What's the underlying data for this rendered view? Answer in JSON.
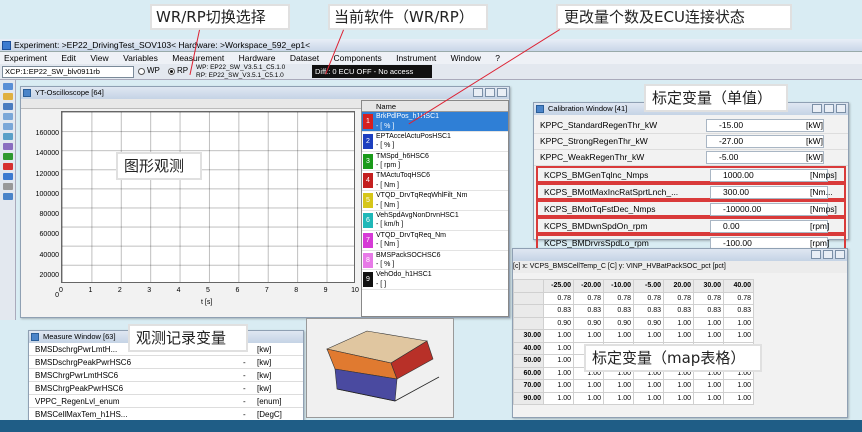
{
  "callouts": {
    "wp_rp_switch": "WR/RP切换选择",
    "current_software": "当前软件（WR/RP）",
    "change_status": "更改量个数及ECU连接状态",
    "calibration_single": "标定变量（单值）",
    "graph_observe": "图形观测",
    "measure_record": "观测记录变量",
    "calibration_map": "标定变量（map表格）"
  },
  "app": {
    "title": "Experiment: >EP22_DrivingTest_SOV103< Hardware: >Workspace_592_ep1<"
  },
  "menu": [
    "Experiment",
    "Edit",
    "View",
    "Variables",
    "Measurement",
    "Hardware",
    "Dataset",
    "Components",
    "Instrument",
    "Window",
    "?"
  ],
  "toolbar": {
    "xcp_select": "XCP:1:EP22_SW_blv0911rb",
    "radio_wp": "WP",
    "radio_rp": "RP",
    "wp_line": "WP: EP22_SW_V3.5.1_C5.1.0",
    "rp_line": "RP: EP22_SW_V3.5.1_C5.1.0",
    "status": "Diff.: 0    ECU OFF - No access"
  },
  "oscilloscope": {
    "title": "YT-Oscilloscope [64]",
    "list_header": "Name",
    "x_label": "t [s]",
    "signals": [
      {
        "num": "1",
        "name": "BrkPdlPos_h1HSC1",
        "unit": "- [ % ]",
        "color": "#d42020"
      },
      {
        "num": "2",
        "name": "EPTAccelActuPosHSC1",
        "unit": "- [ % ]",
        "color": "#1d3fbf"
      },
      {
        "num": "3",
        "name": "TMSpd_h6HSC6",
        "unit": "- [ rpm ]",
        "color": "#1a9a1a"
      },
      {
        "num": "4",
        "name": "TMActuToqHSC6",
        "unit": "- [ Nm ]",
        "color": "#c41f1f"
      },
      {
        "num": "5",
        "name": "VTQD_DrvTqReqWhlFilt_Nm",
        "unit": "- [ Nm ]",
        "color": "#d6c619"
      },
      {
        "num": "6",
        "name": "VehSpdAvgNonDrvnHSC1",
        "unit": "- [ km/h ]",
        "color": "#1fb8b8"
      },
      {
        "num": "7",
        "name": "VTQD_DrvTqReq_Nm",
        "unit": "- [ Nm ]",
        "color": "#d63ad6"
      },
      {
        "num": "8",
        "name": "BMSPackSOCHSC6",
        "unit": "- [ % ]",
        "color": "#e77ae7"
      },
      {
        "num": "9",
        "name": "VehOdo_h1HSC1",
        "unit": "- [ ]",
        "color": "#111111"
      }
    ]
  },
  "chart_data": {
    "type": "line",
    "title": "",
    "xlabel": "t [s]",
    "ylabel": "",
    "x_ticks": [
      "0",
      "1",
      "2",
      "3",
      "4",
      "5",
      "6",
      "7",
      "8",
      "9",
      "10"
    ],
    "y_ticks": [
      "160000",
      "140000",
      "120000",
      "100000",
      "80000",
      "60000",
      "40000",
      "20000",
      "0"
    ],
    "xlim": [
      0,
      10
    ],
    "ylim": [
      0,
      170000
    ],
    "series": [],
    "grid": true
  },
  "calibration": {
    "title": "Calibration Window [41]",
    "rows": [
      {
        "name": "KPPC_StandardRegenThr_kW",
        "value": "-15.00",
        "unit": "[kW]",
        "highlight": false
      },
      {
        "name": "KPPC_StrongRegenThr_kW",
        "value": "-27.00",
        "unit": "[kW]",
        "highlight": false
      },
      {
        "name": "KPPC_WeakRegenThr_kW",
        "value": "-5.00",
        "unit": "[kW]",
        "highlight": false
      },
      {
        "name": "KCPS_BMGenTqlnc_Nmps",
        "value": "1000.00",
        "unit": "[Nmps]",
        "highlight": true
      },
      {
        "name": "KCPS_BMotMaxIncRatSprtLnch_...",
        "value": "300.00",
        "unit": "[Nm...",
        "highlight": true
      },
      {
        "name": "KCPS_BMotTqFstDec_Nmps",
        "value": "-10000.00",
        "unit": "[Nmps]",
        "highlight": true
      },
      {
        "name": "KCPS_BMDwnSpdOn_rpm",
        "value": "0.00",
        "unit": "[rpm]",
        "highlight": true
      },
      {
        "name": "KCPS_BMDrvrsSpdLo_rpm",
        "value": "-100.00",
        "unit": "[rpm]",
        "highlight": true
      }
    ]
  },
  "map": {
    "axis_info": "[c]    x:  VCPS_BMSCellTemp_C [C]              y:  VINP_HVBatPackSOC_pct [pct]",
    "header": [
      "-25.00",
      "-20.00",
      "-10.00",
      "-5.00",
      "20.00",
      "30.00",
      "40.00"
    ],
    "rows": [
      {
        "y": "",
        "v": [
          "0.78",
          "0.78",
          "0.78",
          "0.78",
          "0.78",
          "0.78",
          "0.78"
        ]
      },
      {
        "y": "",
        "v": [
          "0.83",
          "0.83",
          "0.83",
          "0.83",
          "0.83",
          "0.83",
          "0.83"
        ]
      },
      {
        "y": "",
        "v": [
          "0.90",
          "0.90",
          "0.90",
          "0.90",
          "1.00",
          "1.00",
          "1.00"
        ]
      },
      {
        "y": "30.00",
        "v": [
          "1.00",
          "1.00",
          "1.00",
          "1.00",
          "1.00",
          "1.00",
          "1.00"
        ]
      },
      {
        "y": "40.00",
        "v": [
          "1.00",
          "1.00",
          "1.00",
          "1.00",
          "1.00",
          "1.00",
          "1.00"
        ]
      },
      {
        "y": "50.00",
        "v": [
          "1.00",
          "1.00",
          "1.00",
          "1.00",
          "1.00",
          "1.00",
          "1.00"
        ]
      },
      {
        "y": "60.00",
        "v": [
          "1.00",
          "1.00",
          "1.00",
          "1.00",
          "1.00",
          "1.00",
          "1.00"
        ]
      },
      {
        "y": "70.00",
        "v": [
          "1.00",
          "1.00",
          "1.00",
          "1.00",
          "1.00",
          "1.00",
          "1.00"
        ]
      },
      {
        "y": "90.00",
        "v": [
          "1.00",
          "1.00",
          "1.00",
          "1.00",
          "1.00",
          "1.00",
          "1.00"
        ]
      }
    ]
  },
  "measure": {
    "title": "Measure Window [63]",
    "rows": [
      {
        "name": "BMSDschrgPwrLmtH...",
        "unit": "[kw]"
      },
      {
        "name": "BMSDschrgPeakPwrHSC6",
        "unit": "[kw]"
      },
      {
        "name": "BMSChrgPwrLmtHSC6",
        "unit": "[kw]"
      },
      {
        "name": "BMSChrgPeakPwrHSC6",
        "unit": "[kw]"
      },
      {
        "name": "VPPC_RegenLvl_enum",
        "unit": "[enum]"
      },
      {
        "name": "BMSCellMaxTem_h1HS...",
        "unit": "[DegC]"
      }
    ]
  },
  "colors": {
    "highlight_border": "#d93a3a",
    "selected_signal": "#2f7fd6",
    "status_bg": "#111111"
  }
}
